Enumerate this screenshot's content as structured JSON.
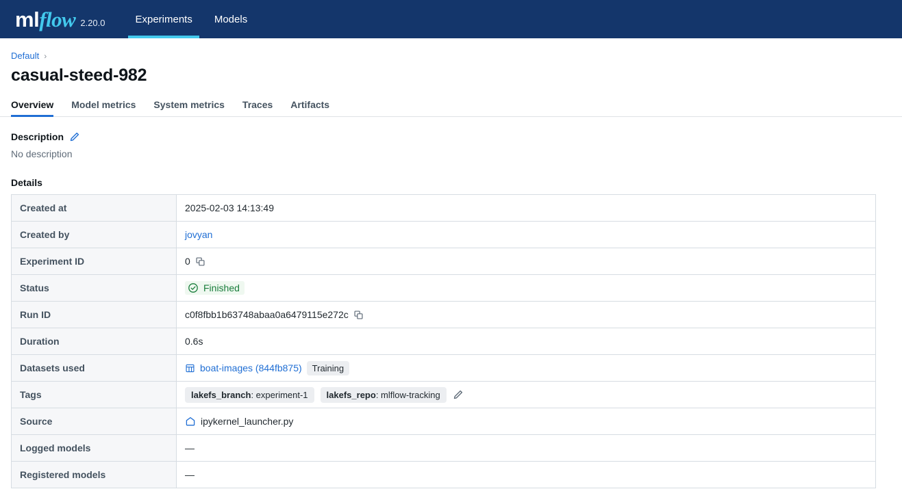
{
  "navbar": {
    "logo_ml": "ml",
    "logo_flow": "flow",
    "version": "2.20.0",
    "links": [
      {
        "label": "Experiments",
        "active": true
      },
      {
        "label": "Models",
        "active": false
      }
    ]
  },
  "breadcrumb": {
    "parent": "Default",
    "separator": "›"
  },
  "page_title": "casual-steed-982",
  "tabs": [
    {
      "label": "Overview",
      "active": true
    },
    {
      "label": "Model metrics",
      "active": false
    },
    {
      "label": "System metrics",
      "active": false
    },
    {
      "label": "Traces",
      "active": false
    },
    {
      "label": "Artifacts",
      "active": false
    }
  ],
  "description": {
    "heading": "Description",
    "edit_icon": "pencil-icon",
    "body": "No description"
  },
  "details": {
    "heading": "Details",
    "rows": {
      "created_at": {
        "label": "Created at",
        "value": "2025-02-03 14:13:49"
      },
      "created_by": {
        "label": "Created by",
        "value": "jovyan"
      },
      "experiment_id": {
        "label": "Experiment ID",
        "value": "0",
        "copy_icon": "copy-icon"
      },
      "status": {
        "label": "Status",
        "value": "Finished",
        "icon": "check-circle-icon",
        "color": "#197d3b",
        "background": "#eff8f0"
      },
      "run_id": {
        "label": "Run ID",
        "value": "c0f8fbb1b63748abaa0a6479115e272c",
        "copy_icon": "copy-icon"
      },
      "duration": {
        "label": "Duration",
        "value": "0.6s"
      },
      "datasets_used": {
        "label": "Datasets used",
        "icon": "table-icon",
        "dataset_name": "boat-images (844fb875)",
        "badge": "Training"
      },
      "tags": {
        "label": "Tags",
        "items": [
          {
            "key": "lakefs_branch",
            "sep": ": ",
            "value": "experiment-1"
          },
          {
            "key": "lakefs_repo",
            "sep": ": ",
            "value": "mlflow-tracking"
          }
        ],
        "edit_icon": "pencil-icon"
      },
      "source": {
        "label": "Source",
        "icon": "home-icon",
        "value": "ipykernel_launcher.py"
      },
      "logged_models": {
        "label": "Logged models",
        "value": "—"
      },
      "registered_models": {
        "label": "Registered models",
        "value": "—"
      }
    }
  },
  "colors": {
    "navbar_bg": "#14366b",
    "accent_cyan": "#43c9ed",
    "link_blue": "#1f6ed4",
    "success_green": "#197d3b",
    "label_bg": "#f6f7f9",
    "border": "#d6dce2"
  }
}
